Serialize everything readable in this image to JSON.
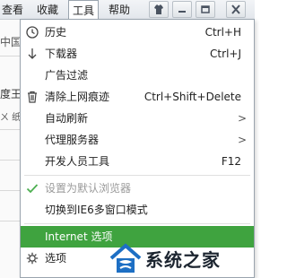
{
  "menubar": {
    "items": [
      "查看",
      "收藏",
      "工具",
      "帮助"
    ]
  },
  "background": {
    "texts": [
      "中国版",
      "度王",
      "ㄨ 纸 ×"
    ]
  },
  "menu": {
    "items": [
      {
        "label": "历史",
        "shortcut": "Ctrl+H",
        "icon": "clock-icon"
      },
      {
        "label": "下载器",
        "shortcut": "Ctrl+J",
        "icon": "download-arrow-icon"
      },
      {
        "label": "广告过滤"
      },
      {
        "label": "清除上网痕迹",
        "shortcut": "Ctrl+Shift+Delete",
        "icon": "trash-icon"
      },
      {
        "label": "自动刷新",
        "submenu": true
      },
      {
        "label": "代理服务器",
        "submenu": true
      },
      {
        "label": "开发人员工具",
        "shortcut": "F12"
      },
      {
        "label": "设置为默认浏览器",
        "disabled": true,
        "icon": "checkmark-icon"
      },
      {
        "label": "切换到IE6多窗口模式"
      },
      {
        "label": "Internet 选项",
        "highlighted": true
      },
      {
        "label": "选项",
        "icon": "gear-icon"
      }
    ],
    "submenu_arrow": ">"
  },
  "watermark": {
    "text": "系统之家"
  },
  "colors": {
    "highlight": "#3fa33f",
    "check": "#4caf50"
  }
}
